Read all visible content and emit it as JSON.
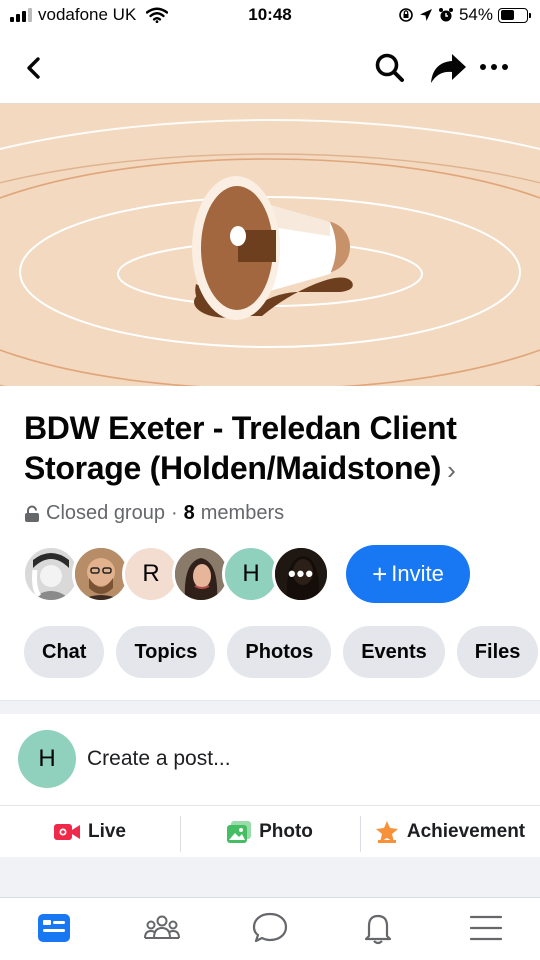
{
  "status_bar": {
    "carrier": "vodafone UK",
    "time": "10:48",
    "battery": "54%",
    "battery_level": 0.54
  },
  "nav": {
    "back_icon": "chevron-left-icon",
    "search_icon": "search-icon",
    "share_icon": "share-arrow-icon",
    "more_icon": "more-dots-icon"
  },
  "cover": {
    "icon": "megaphone-illustration",
    "background_color": "#f2d9c0"
  },
  "group": {
    "title": "BDW Exeter - Treledan Client Storage (Holden/Maidstone)",
    "chevron": "›",
    "privacy": "Closed group",
    "separator": "·",
    "member_count": "8",
    "members_label": "members"
  },
  "members": [
    {
      "type": "photo",
      "icon": "member-photo-1"
    },
    {
      "type": "photo",
      "icon": "member-photo-2"
    },
    {
      "type": "initial",
      "initial": "R",
      "color": "#f2ddd0"
    },
    {
      "type": "photo",
      "icon": "member-photo-3"
    },
    {
      "type": "initial",
      "initial": "H",
      "color": "#8fd1bd"
    },
    {
      "type": "more",
      "label": "•••"
    }
  ],
  "invite": {
    "plus": "+",
    "label": "Invite",
    "color": "#1877f2"
  },
  "tabs": [
    "Chat",
    "Topics",
    "Photos",
    "Events",
    "Files"
  ],
  "composer": {
    "initial": "H",
    "placeholder": "Create a post..."
  },
  "actions": [
    {
      "label": "Live",
      "icon": "live-video-icon",
      "color": "#f02849"
    },
    {
      "label": "Photo",
      "icon": "photo-icon",
      "color": "#45bd62"
    },
    {
      "label": "Achievement",
      "icon": "star-achievement-icon",
      "color": "#f7923b"
    }
  ],
  "tabbar": [
    {
      "icon": "groups-feed-icon",
      "active": true
    },
    {
      "icon": "members-icon",
      "active": false
    },
    {
      "icon": "chat-bubble-icon",
      "active": false
    },
    {
      "icon": "bell-icon",
      "active": false
    },
    {
      "icon": "menu-icon",
      "active": false
    }
  ]
}
